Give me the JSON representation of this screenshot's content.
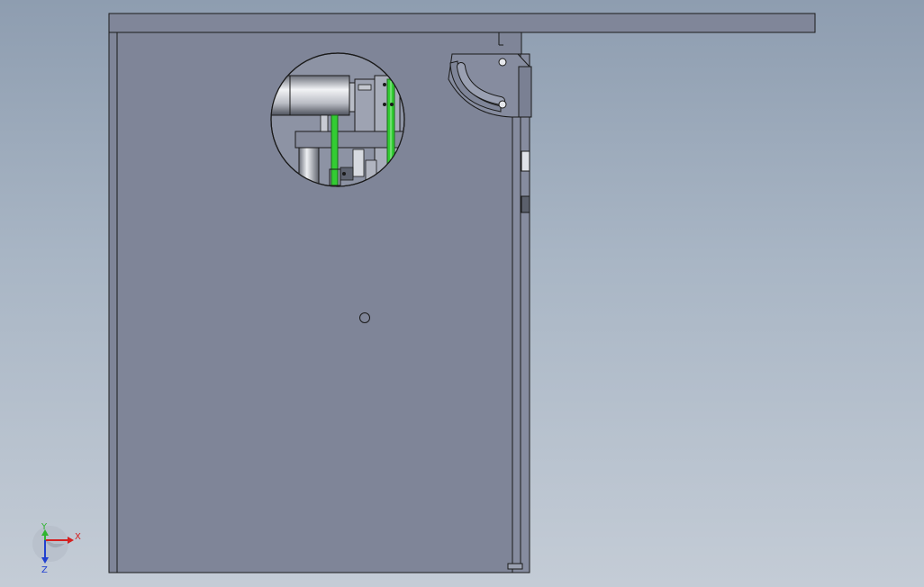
{
  "view": {
    "background_top": "#8e9db0",
    "background_bottom": "#c4ccd6",
    "part_fill": "#7f8598",
    "edge_color": "#1a1a1a",
    "highlight_color": "#33cc33"
  },
  "triad": {
    "x_label": "X",
    "y_label": "Y",
    "z_label": "Z",
    "x_color": "#d42020",
    "y_color": "#2fb42f",
    "z_color": "#2040d0"
  }
}
